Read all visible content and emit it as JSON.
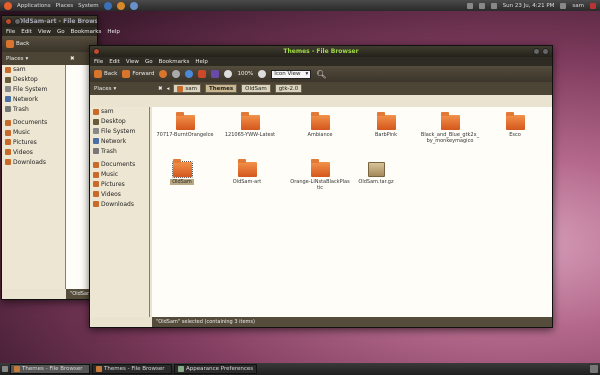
{
  "top_panel": {
    "menus": [
      "Applications",
      "Places",
      "System"
    ],
    "clock": "Sun 23 Ju,  4:21 PM",
    "user": "sam"
  },
  "back_window": {
    "title": "OldSam-art - File Browser",
    "menus": [
      "File",
      "Edit",
      "View",
      "Go",
      "Bookmarks",
      "Help"
    ],
    "back_label": "Back",
    "places_label": "Places",
    "places": [
      "sam",
      "Desktop",
      "File System",
      "Network",
      "Trash"
    ],
    "places2": [
      "Documents",
      "Music",
      "Pictures",
      "Videos",
      "Downloads"
    ],
    "status": "\"OldSam"
  },
  "front_window": {
    "title": "Themes - File Browser",
    "menus": [
      "File",
      "Edit",
      "View",
      "Go",
      "Bookmarks",
      "Help"
    ],
    "toolbar": {
      "back": "Back",
      "forward": "Forward",
      "zoom": "100%",
      "view": "Icon View"
    },
    "places_label": "Places",
    "crumbs": [
      "sam",
      "Themes",
      "OldSam",
      "gtk-2.0"
    ],
    "places": [
      "sam",
      "Desktop",
      "File System",
      "Network",
      "Trash"
    ],
    "places2": [
      "Documents",
      "Music",
      "Pictures",
      "Videos",
      "Downloads"
    ],
    "files": [
      {
        "name": "70717-BurntOrangeIce",
        "kind": "folder"
      },
      {
        "name": "121065-YWW-Latest",
        "kind": "folder"
      },
      {
        "name": "Ambiance",
        "kind": "folder"
      },
      {
        "name": "BarbPink",
        "kind": "folder"
      },
      {
        "name": "Black_and_Blue_gtk2x_by_monkeymagico",
        "kind": "folder"
      },
      {
        "name": "Esco",
        "kind": "folder"
      },
      {
        "name": "OldSam",
        "kind": "folder",
        "selected": true
      },
      {
        "name": "OldSam-art",
        "kind": "folder"
      },
      {
        "name": "Orange-LiNstaBlackPlastic",
        "kind": "folder"
      },
      {
        "name": "OldSam.tar.gz",
        "kind": "archive"
      }
    ],
    "status": "\"OldSam\" selected (containing 3 items)"
  },
  "taskbar": [
    {
      "label": "Themes - File Browser",
      "active": true
    },
    {
      "label": "Themes - File Browser",
      "active": false
    },
    {
      "label": "Appearance Preferences",
      "active": false
    }
  ]
}
